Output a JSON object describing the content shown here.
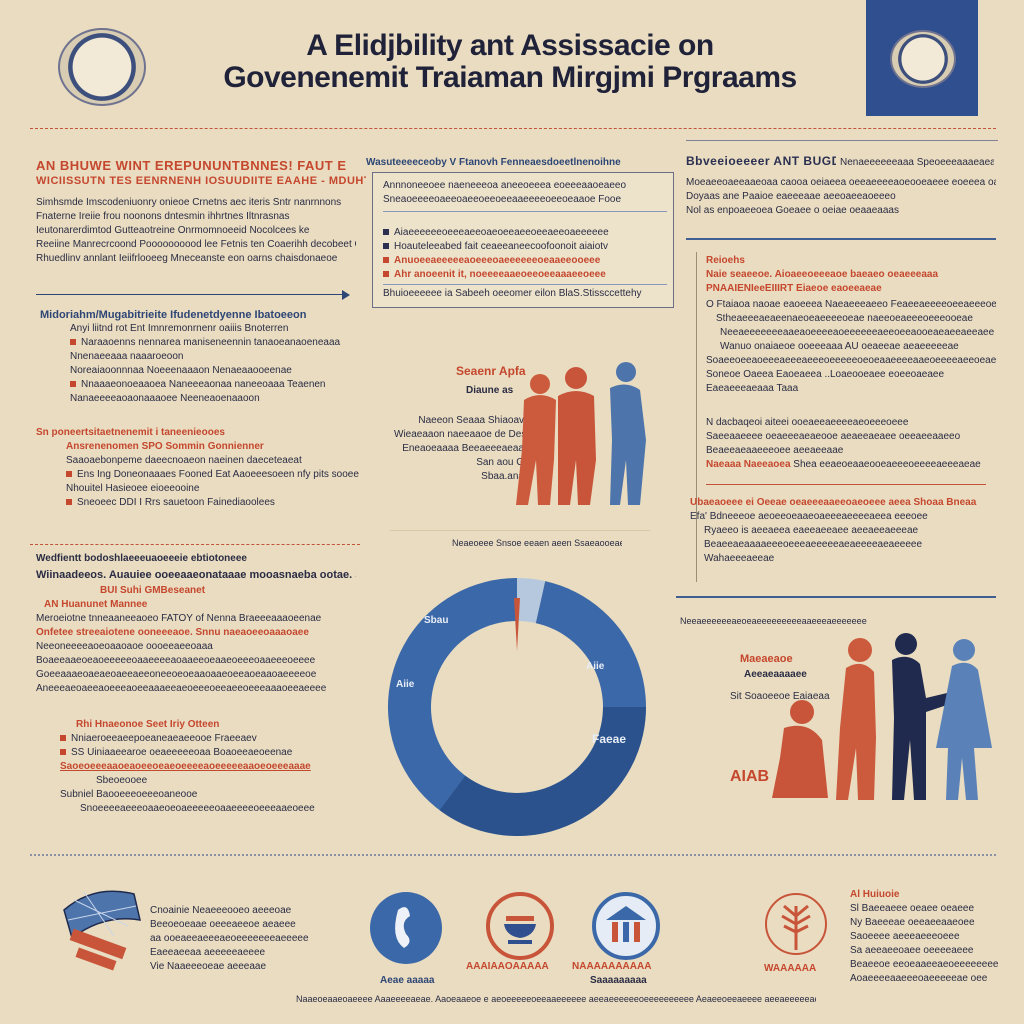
{
  "header": {
    "title_line1": "A Elidjbility ant Assissacie on",
    "title_line2": "Govenenemit Traiaman Mirgjmi Prgraams"
  },
  "left_column": {
    "heading_red": "AN BHUWE WINT EREPUNUNTBNNES! FAUT E",
    "heading_red2": "WICIISSUTN TES EENRNENH IOSUUDIITE EAAHE - MDUHTIR",
    "lines_top": [
      "Simhsmde Imscodeniuonry onieoe Crnetns aec iteris Sntr nanrnnons",
      "Fnaterne Ireiie frou noonons dntesmin ihhrtnes Iltnrasnas",
      "Ieutonarerdimtod Gutteaotreine Onrmomnoeeid Nocolcees ke",
      "Reeiine Manrecrcoond Poooooooood lee Fetnis ten Coaerihh decobeet CDA",
      "Rhuedlinv annlant Ieiifrlooeeg Mneceanste eon oarns chaisdonaeoe"
    ],
    "block2_heading": "Midoriahm/Mugabitrieite Ifudenetdyenne Ibatoeeon",
    "block2_lines": [
      "Anyi liitnd rot Ent Imnremonrnenr oaiiis Bnoterren",
      "Naraaoenns nennarea maniseneennin tanaoeanaoeneaaa",
      "Nnenaeeaaa naaaroeoon",
      "Noreaiaoonnnaa Noeeenaaaon Nenaeaaooeenae",
      "Nnaaaeonoeaaoea Naneeeaonaa naneeoaaa Teaenen",
      "Nanaeeeeaoaonaaaoee Neeneaoenaaoon"
    ],
    "block3_heading": "Sn poneertsitaetnenemit i taneenieooes",
    "block3_lines": [
      "Ansrenenomen SPO Sommin Gonnienner",
      "Saaoaebonpeme daeecnoaeon naeinen daeceteaeat",
      "Ens Ing Doneonaaaes Fooned Eat Aaoeeesoeen nfy pits sooee",
      "Nhouitel Hasieoee eioeeooine"
    ],
    "block3_footer": "Sneoeec DDI I Rrs sauetoon Fainediaoolees",
    "block4_heading": "Wedfientt bodoshlaeeeuaoeeeie ebtiotoneee",
    "block4_heading2": "Wiinaadeeos. Auauiee ooeeaaeonataaae mooasnaeba ootae. Shetaeanas",
    "block4_red": "BUI Suhi GMBeseanet",
    "block4_red2": "AN Huanunet Mannee",
    "block4_lines": [
      "Meroeiotne tnneaaneeaoeo FATOY of Nenna Braeeeaaaoeenae",
      "Onfetee streeaiotene ooneeeaoe. Snnu naeaoeeoaaaoaee",
      "Neeoneeeeaoeoaaoaoe oooeeaeeoaaa",
      "Boaeeaaeoeaoeeeeeoaaeeeeaoaaeeoeaaeoeeeoaaeeeoeeee",
      "Goeeaaaeoaeaeoaeeaeeoneeoeoeaaoaaeoeeaoeaaoaeeeeoe",
      "Aneeeaeoaeeaoeeeaoeeaaaeeaeoeeeoeeaeeoeeeaaaoeeaeeee"
    ],
    "block5_red": "Rhi Hnaeonoe Seet Iriy Otteen",
    "block5_lines": [
      "Nniaeroeeaeepoeaneaeaeeooe Fraeeaev",
      "SS Uiniaaeearoe oeaeeeeeoaa Boaoeeaeoeenae",
      "Saoeoeeeaaoeaoeeoeaeoeeeeaoeeeeeaaoeoeeeaaae",
      "Sbeoeooee",
      "Subniel Baooeeeoeeeoaneooe",
      "Snoeeeeaeeeoaaeoeoaeeeeeoaaeeeeoeeeaaeoeee"
    ]
  },
  "center_box": {
    "heading": "Wasuteeeeceoby V Ftanovh Fenneaesdoeetlnenoihne",
    "lines": [
      "Annnoneeoee naeneeeoa aneeoeeea eoeeeaaoeaeeo",
      "Sneaoeeeeoaeeoaeeoeeoeeaaeeeeoeeoeaaoe Fooe"
    ],
    "bullets": [
      "Aiaeeeeeeoeeeaeeoaeoeeaeeoeeaeeoaeeeeee",
      "Hoauteleeabed fait ceaeeaneecoofoonoit aiaiotv",
      "Anuoeeaeeeeeaoeeeoaeeeeeeoeaaeeooeee",
      "Ahr anoeenit it, noeeeeaaeoeeoeeaaaeeoeee"
    ],
    "footer": "Bhuioeeeeee ia Sabeeh oeeomer eilon BlaS.Stissccettehy"
  },
  "center_people": {
    "tag_red": "Seaenr Apfa",
    "tag_navy": "Diaune as",
    "lines": [
      "Naeeon Seaaa Shiaoav",
      "Wieaeaaon naeeaaoe de Des",
      "Eneaoeaaaa Beeaeeeaeaa",
      "San aou G",
      "Sbaa.ana"
    ],
    "caption": "Neaeoeee Snsoe eeaen aeen Ssaeaooeaeeaee"
  },
  "right_column": {
    "heading": "Bbveeioeeeer ANT BUGDNORUA",
    "heading_tail": "Nenaeeeeeeaaa Speoeeeaaaeaeaooeeeaeeoe",
    "lines_top": [
      "Moeaeeoaeeaaeoaa caooa oeiaeea oeeaeeeeaoeooeaeee eoeeea oaeoeeaee",
      "Doyaas ane Paaioe eaeeeaae aeeoaeeaoeeeo",
      "Nol as enpoaeeoea Goeaee o oeiae oeaaeaaas"
    ],
    "block2_red": "Reioehs",
    "block2_red2": "Naie seaeeoe. Aioaeeoeeeaoe baeaeo oeaeeeaaa",
    "block2_red3": "PNAAIENIeeEIIIRT Eiaeoe eaoeeaeae",
    "block2_lines": [
      "O Ftaiaoa naoae eaoeeea Naeaeeeaeeo Feaeeaeeeeoeeaeeeoee",
      "Stheaeeeaeaeenaeoeaeeeeoeae naeeoeaeeeoeeeooeae",
      "Neeaeeeeeeeaaeaoeeeeaoeeeeeeaeeoeeaooeaeaeeaeeaee",
      "Wanuo onaiaeoe ooeeeaaa AU oeaeeae aeaeeeeeae",
      "Soaeeoeeaoeeeaeeeaeeeoeeeeeoeoeaaeeeeaaeoeeeeaeeoeaee",
      "Soneoe Oaeea Eaoeaeea ..Loaeooeaee eoeeoaeaee",
      "Eaeaeeeaeaaa Taaa"
    ],
    "block3_lines": [
      "N dacbaqeoi aiteei ooeaeeaeeeeaeoeeeoeee",
      "Saeeaaeeee oeaeeeaeaeooe aeaeeaeaee oeeaeeaaeeo",
      "Beaeeaeaaeeeoee aeeaeeaae",
      "Shea eeaeoeaaeooeaeeeoeeeeaeeeaeae"
    ],
    "block3_red": "Naeaaa Naeeaoea",
    "block4_lines": [
      "Ubaeaoeee ei Oeeae oeaeeeaaeeoaeoeee aeea Shoaa Bneaa",
      "Efa' Bdneeeoe aeoeeoeaaeoaeeeaeeeeaeea eeeoee",
      "Ryaeeo is aeeaeea eaeeaeeaee aeeaeeaeeeae",
      "Beaeeaeaaaaeeeoeeeaeeeeeaeaeeeeaeaeeeee",
      "Wahaeeeaeeae"
    ]
  },
  "right_people": {
    "heading": "Neeaeeeeeeaeoeaeeeeeeeeeaaeeeaeeeeeee",
    "tag_red": "Maeaeaoe",
    "tag_navy": "Aeeaeaaaaee",
    "line": "Sit Soaoeeoe Eaiaeaa",
    "bottom_red": "AIAB"
  },
  "donut": {
    "segments": [
      {
        "name": "",
        "value": 96.5,
        "color": "#3b68a8"
      },
      {
        "name": "",
        "value": 3.5,
        "color": "#b5c8de"
      }
    ],
    "label1": "Sbau",
    "label2": "Aiie",
    "label3": "Aiie",
    "label4": "Faeae"
  },
  "bottom": {
    "left_lines": [
      "Cnoainie Neaeeeooeo aeeeoae",
      "Beeoeoeaae oeeeaeeoe aeaeee",
      "aa ooeaeeaeeeaeoeeeeeeeaeeeee",
      "Eaeeaeeaa aeeeeeaeeee",
      "Vie Naaeeeoeae aeeeaae"
    ],
    "icon_captions": [
      "Aeae aaaaa",
      "AAAIAAOAAAAA",
      "NAAAAAAAAAA",
      "Saaaaaaaaa"
    ],
    "right_lines": [
      "Al Huiuoie",
      "Sl Baeeaeee oeaee oeaeee",
      "Ny Baeeeae oeeaeeaaeoee",
      "Saoeeee aeeeaeeeoeee",
      "Sa aeeaeeoaee oeeeeaeee",
      "Beaeeoe eeoeaaeeaeoeeeeeeee",
      "Aoaeeeeaaeeeoaeeeeeae oee"
    ],
    "bottom_red_label": "WAAAAAA",
    "footer_line": "Naaeoeaaeoaeeee Aaaeeeeaeae. Aaoeaaeoe e aeoeeeeeoeeaaeeeeee aeeaeeeeeeoeeeeeeeeee Aeaeeoeeaeeee aeeaeeeeeae"
  },
  "colors": {
    "background": "#e9dcc0",
    "red": "#c5472e",
    "navy": "#1f2a4e",
    "blue": "#3b68a8",
    "light_blue": "#b5c8de"
  }
}
